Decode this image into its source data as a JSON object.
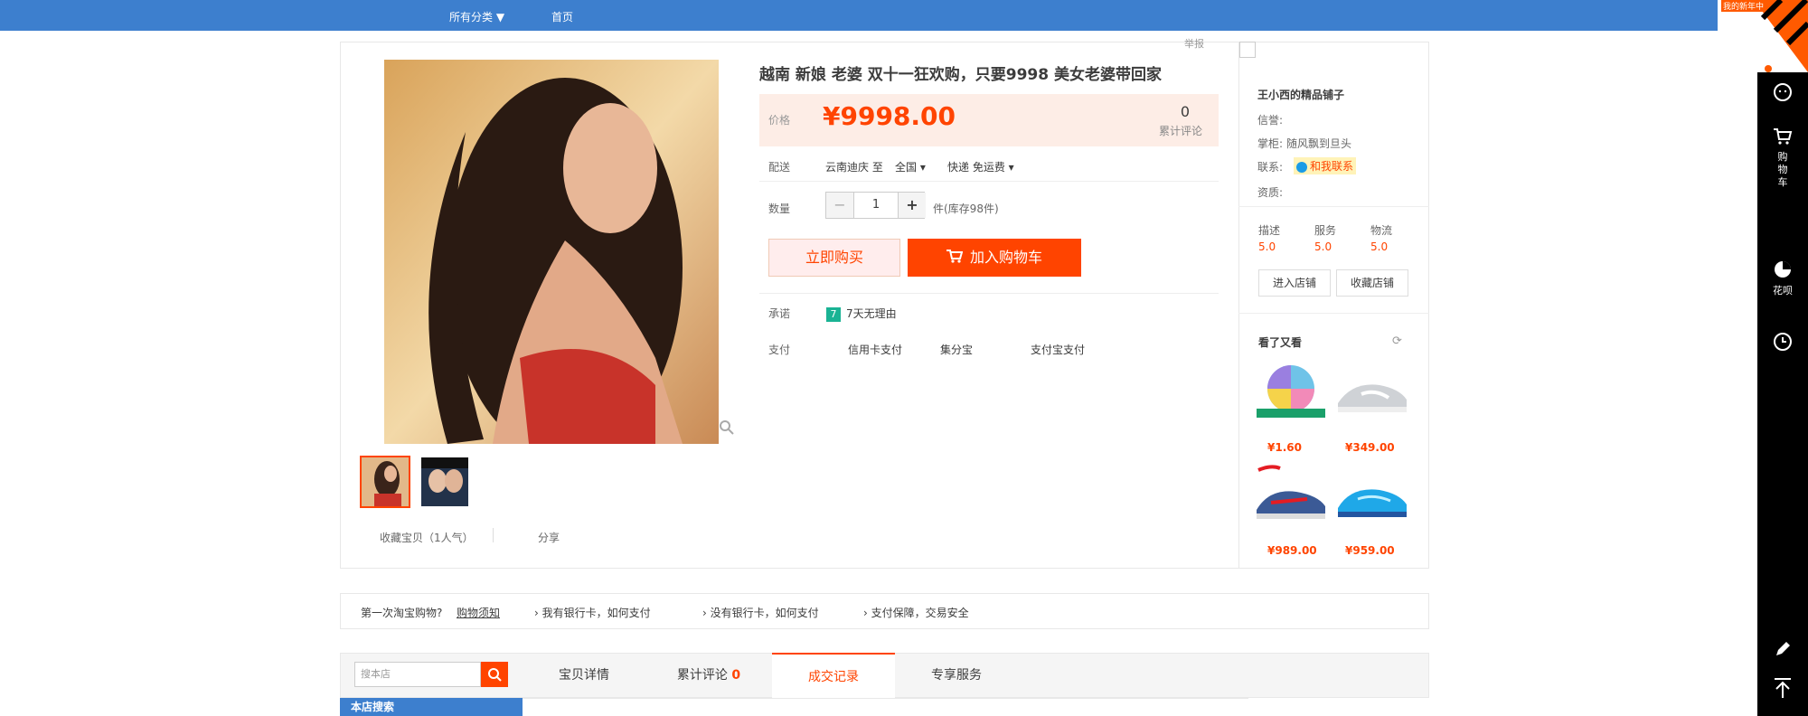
{
  "topbar": {
    "all_categories": "所有分类 ▼",
    "home": "首页"
  },
  "report": "举报",
  "product": {
    "title": "越南 新娘 老婆 双十一狂欢购，只要9998 美女老婆带回家",
    "price_label": "价格",
    "price": "¥9998.00",
    "review_count": "0",
    "review_label": "累计评论",
    "delivery_label": "配送",
    "delivery_from": "云南迪庆 至",
    "delivery_to": "全国 ▾",
    "delivery_shipping": "快递 免运费 ▾",
    "qty_label": "数量",
    "qty_minus": "−",
    "qty_value": "1",
    "qty_plus": "+",
    "stock": "件(库存98件)",
    "buy_now": "立即购买",
    "add_cart": "加入购物车",
    "promise_label": "承诺",
    "promise_icon": "7",
    "promise": "7天无理由",
    "pay_label": "支付",
    "pay_methods": [
      "信用卡支付",
      "集分宝",
      "支付宝支付"
    ],
    "favorite": "收藏宝贝（1人气）",
    "share": "分享"
  },
  "shop": {
    "name": "王小西的精品铺子",
    "credit_label": "信誉:",
    "seller_label": "掌柜:",
    "seller": "随风飘到旦头",
    "contact_label": "联系:",
    "contact_btn": "和我联系",
    "qualification_label": "资质:",
    "ratings": [
      {
        "label": "描述",
        "value": "5.0"
      },
      {
        "label": "服务",
        "value": "5.0"
      },
      {
        "label": "物流",
        "value": "5.0"
      }
    ],
    "enter_shop": "进入店铺",
    "favorite_shop": "收藏店铺",
    "seen_title": "看了又看",
    "recs": [
      "¥1.60",
      "¥349.00",
      "¥989.00",
      "¥959.00"
    ]
  },
  "guide": {
    "first_time": "第一次淘宝购物?",
    "guide_link": "购物须知",
    "items": [
      "› 我有银行卡，如何支付",
      "› 没有银行卡，如何支付",
      "› 支付保障，交易安全"
    ]
  },
  "tabs": {
    "search_placeholder": "搜本店",
    "items": [
      "宝贝详情",
      "累计评论",
      "成交记录",
      "专享服务"
    ],
    "review_count": "0",
    "shop_search": "本店搜索"
  },
  "sidebar": {
    "cart": "购物车",
    "huabei": "花呗"
  },
  "corner_badge": "我的新年中"
}
